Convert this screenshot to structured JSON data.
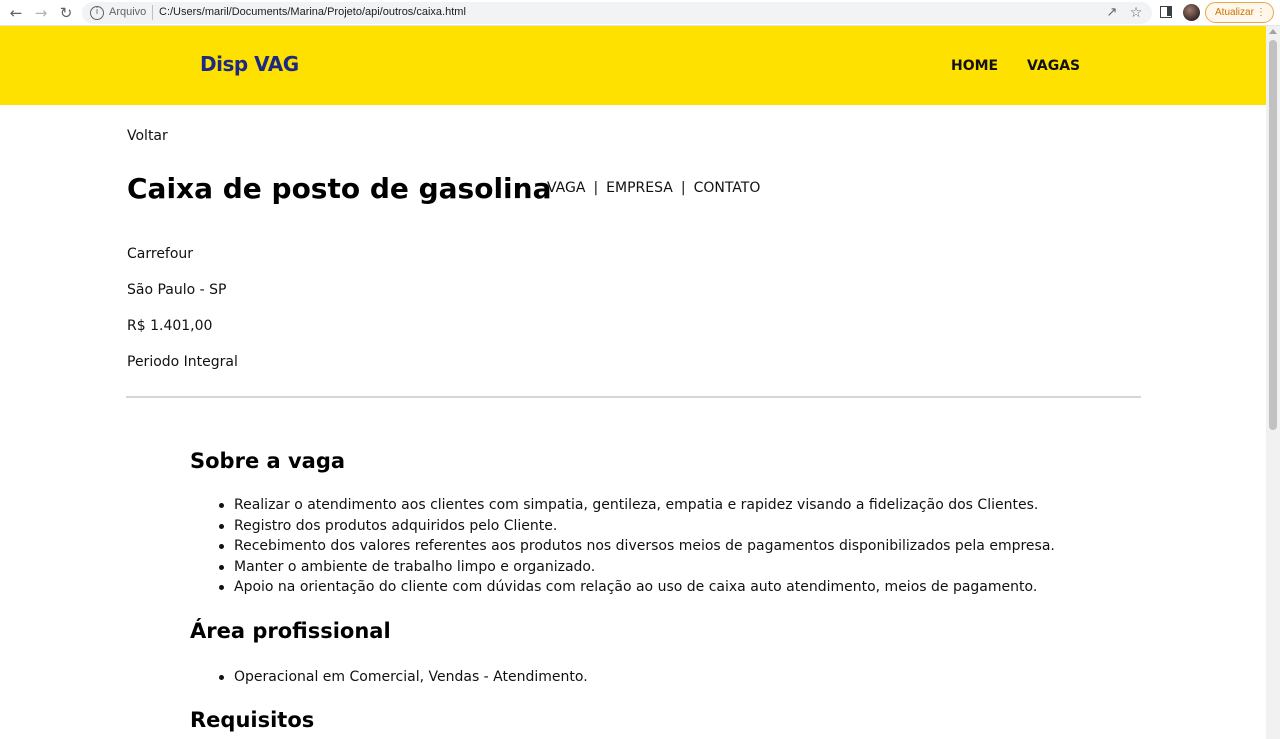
{
  "browser": {
    "arquivo_label": "Arquivo",
    "url": "C:/Users/maril/Documents/Marina/Projeto/api/outros/caixa.html",
    "update_label": "Atualizar",
    "icons": [
      "back-arrow-icon",
      "forward-arrow-icon",
      "reload-icon",
      "info-icon",
      "share-icon",
      "star-icon",
      "side-panel-icon",
      "avatar",
      "more-icon"
    ]
  },
  "header": {
    "logo": "Disp VAG",
    "nav": [
      {
        "label": "HOME"
      },
      {
        "label": "VAGAS"
      }
    ],
    "background": "#ffe100",
    "logo_color": "#1d2a85"
  },
  "page": {
    "back_link": "Voltar",
    "title": "Caixa de posto de gasolina",
    "subnav": [
      {
        "label": "VAGA"
      },
      {
        "label": "EMPRESA"
      },
      {
        "label": "CONTATO"
      }
    ],
    "subnav_separator": "|",
    "details": {
      "company": "Carrefour",
      "location": "São Paulo - SP",
      "salary": "R$ 1.401,00",
      "schedule": "Periodo Integral"
    }
  },
  "sections": [
    {
      "title": "Sobre a vaga",
      "items": [
        "Realizar o atendimento aos clientes com simpatia, gentileza, empatia e rapidez visando a fidelização dos Clientes.",
        "Registro dos produtos adquiridos pelo Cliente.",
        "Recebimento dos valores referentes aos produtos nos diversos meios de pagamentos disponibilizados pela empresa.",
        "Manter o ambiente de trabalho limpo e organizado.",
        "Apoio na orientação do cliente com dúvidas com relação ao uso de caixa auto atendimento, meios de pagamento."
      ]
    },
    {
      "title": "Área profissional",
      "items": [
        "Operacional em Comercial, Vendas - Atendimento."
      ]
    },
    {
      "title": "Requisitos",
      "items": []
    }
  ]
}
